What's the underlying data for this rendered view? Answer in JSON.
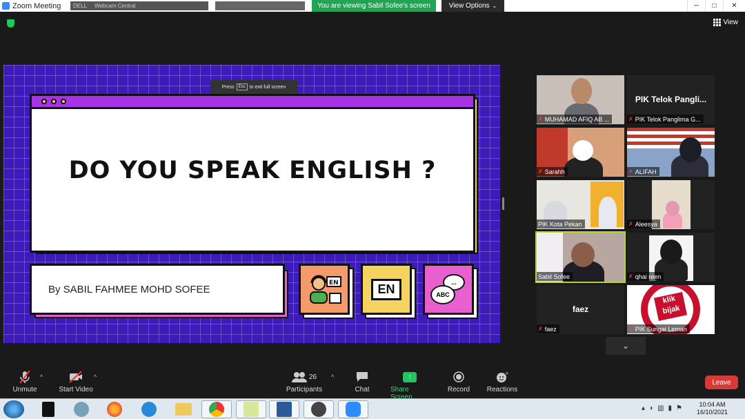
{
  "window": {
    "title": "Zoom Meeting",
    "viewing_banner": "You are viewing Sabil Sofee's screen",
    "view_options": "View Options",
    "view_button": "View",
    "minimize": "─",
    "maximize": "□",
    "close": "✕"
  },
  "background_tabs": [
    "DELL",
    "Webcam Central"
  ],
  "share": {
    "esc_press": "Press",
    "esc_key": "Esc",
    "esc_suffix": "to exit full screen",
    "slide_title": "DO YOU SPEAK ENGLISH ?",
    "byline": "By SABIL FAHMEE MOHD SOFEE",
    "card_en": "EN",
    "card_abc": "ABC",
    "card_dots": "..."
  },
  "participants": [
    {
      "name": "MUHAMAD AFIQ AB ...",
      "muted": true
    },
    {
      "name": "PIK Telok Panglima G...",
      "display": "PIK Telok Pangli...",
      "muted": true
    },
    {
      "name": "Sarahh",
      "muted": true
    },
    {
      "name": "ALIFAH",
      "muted": true
    },
    {
      "name": "PIK Kota Pekan",
      "muted": false
    },
    {
      "name": "Aleesya",
      "muted": true
    },
    {
      "name": "Sabil Sofee",
      "muted": false
    },
    {
      "name": "qhai reen",
      "muted": true
    },
    {
      "name": "faez",
      "display": "faez",
      "muted": true
    },
    {
      "name": "PIK Sungai Leman",
      "muted": true
    }
  ],
  "tile_logo": {
    "top": "klik",
    "bottom": "bijak"
  },
  "toolbar": {
    "unmute": "Unmute",
    "start_video": "Start Video",
    "participants": "Participants",
    "participants_count": "26",
    "chat": "Chat",
    "share_screen": "Share Screen",
    "record": "Record",
    "reactions": "Reactions",
    "leave": "Leave"
  },
  "taskbar": {
    "time": "10:04 AM",
    "date": "16/10/2021"
  },
  "colors": {
    "share_bg": "#3d1bb8",
    "accent_purple": "#a633e6",
    "accent_yellow": "#f4d35e",
    "accent_pink": "#e85fd0",
    "zoom_green": "#23a455",
    "leave_red": "#d83a3a"
  }
}
